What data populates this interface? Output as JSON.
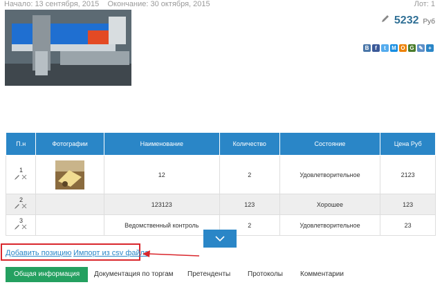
{
  "header": {
    "dates": "Начало: 13 сентября, 2015    Окончание: 30 октября, 2015",
    "lot": "Лот: 1"
  },
  "price": {
    "amount": "5232",
    "currency": "Руб"
  },
  "share_icons": [
    {
      "letter": "В",
      "color": "#4a76a8"
    },
    {
      "letter": "f",
      "color": "#3b5998"
    },
    {
      "letter": "t",
      "color": "#55acee"
    },
    {
      "letter": "М",
      "color": "#168de2"
    },
    {
      "letter": "О",
      "color": "#ee8208"
    },
    {
      "letter": "G",
      "color": "#4a7c2c"
    },
    {
      "letter": "✎",
      "color": "#5e8fc7"
    },
    {
      "letter": "+",
      "color": "#2a86c7"
    }
  ],
  "table": {
    "headers": [
      "П.н",
      "Фотографии",
      "Наименование",
      "Количество",
      "Состояние",
      "Цена Руб"
    ],
    "rows": [
      {
        "num": "1",
        "name": "12",
        "qty": "2",
        "state": "Удовлетворительное",
        "price": "2123"
      },
      {
        "num": "2",
        "name": "123123",
        "qty": "123",
        "state": "Хорошее",
        "price": "123"
      },
      {
        "num": "3",
        "name": "Ведомственный контроль",
        "qty": "2",
        "state": "Удовлетворительное",
        "price": "23"
      }
    ]
  },
  "actions": {
    "add": "Добавить позицию",
    "import": "Импорт из csv файла"
  },
  "tabs": [
    "Общая информация",
    "Документация по торгам",
    "Претенденты",
    "Протоколы",
    "Комментарии"
  ],
  "colors": {
    "accent": "#2a86c7",
    "highlight": "#d9252b",
    "active_tab": "#24a060",
    "price": "#2f6f95"
  }
}
